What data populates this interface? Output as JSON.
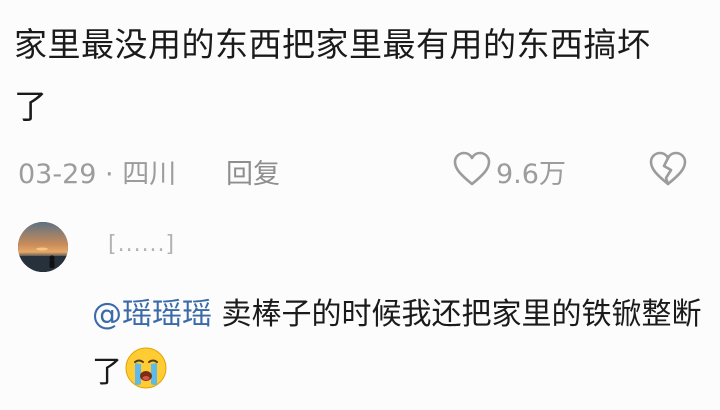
{
  "comment": {
    "text": "家里最没用的东西把家里最有用的东西搞坏了",
    "date_location": "03-29 · 四川",
    "reply_label": "回复",
    "like_count": "9.6万",
    "like_icon": "heart-outline-icon",
    "dislike_icon": "broken-heart-icon"
  },
  "reply": {
    "author_name": "[......]",
    "mention": "@瑶瑶瑶",
    "text": " 卖棒子的时候我还把家里的铁锨整断了",
    "emoji": "crying-face-emoji",
    "colors": {
      "mention": "#3a6aa8",
      "meta": "#9c9c9c"
    }
  }
}
